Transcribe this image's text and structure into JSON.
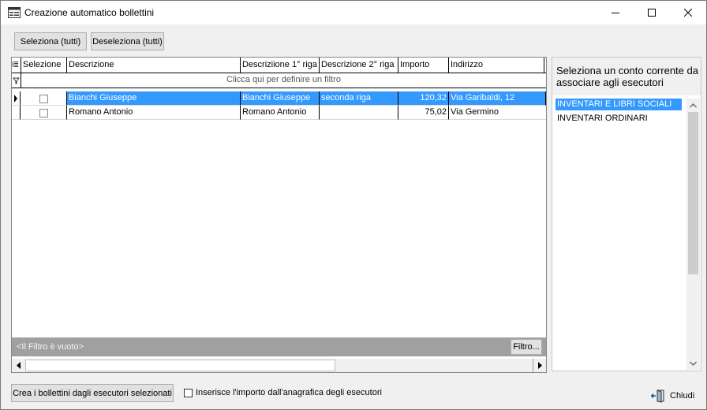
{
  "window": {
    "title": "Creazione automatico bollettini"
  },
  "toolbar": {
    "select_all": "Seleziona (tutti)",
    "deselect_all": "Deseleziona (tutti)"
  },
  "grid": {
    "columns": [
      "Selezione",
      "Descrizione",
      "Descriziione 1° riga",
      "Descrizione 2° riga",
      "Importo",
      "Indirizzo"
    ],
    "filter_hint": "Clicca qui per definire un filtro",
    "rows": [
      {
        "descrizione": "Bianchi Giuseppe",
        "riga1": "Bianchi Giuseppe",
        "riga2": "seconda riga",
        "importo": "120,32",
        "indirizzo": "Via Garibaldi, 12",
        "checked": false,
        "selected": true
      },
      {
        "descrizione": "Romano Antonio",
        "riga1": "Romano Antonio",
        "riga2": "",
        "importo": "75,02",
        "indirizzo": "Via Germino",
        "checked": false,
        "selected": false
      }
    ],
    "filter_status": "<Il Filtro è vuoto>",
    "filter_button": "Filtro..."
  },
  "right_panel": {
    "label": "Seleziona un conto corrente da associare agli esecutori",
    "items": [
      "INVENTARI E LIBRI SOCIALI",
      "INVENTARI ORDINARI"
    ],
    "selected_index": 0
  },
  "bottom": {
    "create_button": "Crea i bollettini dagli esecutori selezionati",
    "import_checkbox_label": "Inserisce l'importo dall'anagrafica degli esecutori",
    "import_checked": false,
    "close_button": "Chiudi"
  },
  "colors": {
    "selection": "#3399ff",
    "filter_bar": "#a0a0a0"
  }
}
